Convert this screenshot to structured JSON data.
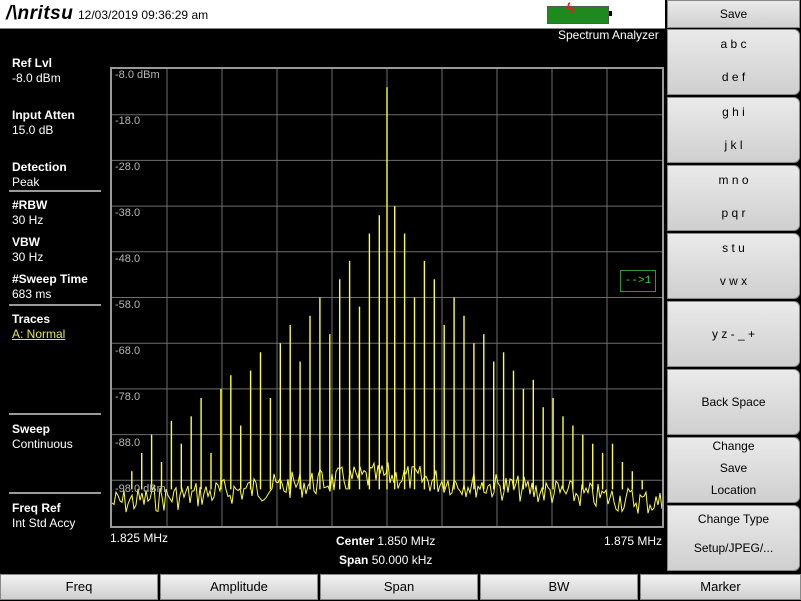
{
  "header": {
    "brand": "/\\nritsu",
    "datetime": "12/03/2019 09:36:29 am",
    "mode": "Spectrum Analyzer"
  },
  "left_panel": {
    "ref_lvl_label": "Ref Lvl",
    "ref_lvl_value": "-8.0 dBm",
    "input_atten_label": "Input Atten",
    "input_atten_value": "15.0 dB",
    "detection_label": "Detection",
    "detection_value": "Peak",
    "rbw_label": "#RBW",
    "rbw_value": "30 Hz",
    "vbw_label": "VBW",
    "vbw_value": "30 Hz",
    "sweep_time_label": "#Sweep Time",
    "sweep_time_value": "683 ms",
    "traces_label": "Traces",
    "traces_value": "A: Normal",
    "sweep_label": "Sweep",
    "sweep_value": "Continuous",
    "freq_ref_label": "Freq Ref",
    "freq_ref_value": "Int Std Accy"
  },
  "plot": {
    "y_labels": [
      "-8.0 dBm",
      "-18.0",
      "-28.0",
      "-38.0",
      "-48.0",
      "-58.0",
      "-68.0",
      "-78.0",
      "-88.0",
      "-98.0 dBm"
    ],
    "x_start": "1.825 MHz",
    "x_stop": "1.875 MHz",
    "center_label": "Center",
    "center_value": "1.850 MHz",
    "span_label": "Span",
    "span_value": "50.000 kHz",
    "marker_indicator": "-->1",
    "trace_color": "#ffff33"
  },
  "chart_data": {
    "type": "line",
    "x_unit": "MHz",
    "y_unit": "dBm",
    "xlim": [
      1.825,
      1.875
    ],
    "ylim": [
      -108,
      -8
    ],
    "grid": true,
    "peaks": {
      "x": [
        1.8268,
        1.8277,
        1.8286,
        1.8295,
        1.8304,
        1.8313,
        1.8322,
        1.8331,
        1.834,
        1.8349,
        1.8358,
        1.8367,
        1.8376,
        1.8385,
        1.8394,
        1.8403,
        1.8412,
        1.8421,
        1.843,
        1.8439,
        1.8448,
        1.8457,
        1.8466,
        1.8475,
        1.8484,
        1.8493,
        1.85,
        1.8507,
        1.8516,
        1.8525,
        1.8534,
        1.8543,
        1.8552,
        1.8561,
        1.857,
        1.8579,
        1.8588,
        1.8597,
        1.8606,
        1.8615,
        1.8624,
        1.8633,
        1.8642,
        1.8651,
        1.866,
        1.8669,
        1.8678,
        1.8687,
        1.8696,
        1.8705,
        1.8714,
        1.8723,
        1.8732
      ],
      "y": [
        -96,
        -92,
        -88,
        -94,
        -85,
        -90,
        -84,
        -80,
        -92,
        -78,
        -75,
        -86,
        -74,
        -70,
        -80,
        -68,
        -64,
        -72,
        -62,
        -58,
        -66,
        -54,
        -50,
        -60,
        -44,
        -40,
        -12,
        -38,
        -44,
        -58,
        -50,
        -54,
        -64,
        -58,
        -62,
        -68,
        -66,
        -72,
        -70,
        -74,
        -78,
        -76,
        -82,
        -80,
        -84,
        -86,
        -88,
        -90,
        -92,
        -90,
        -94,
        -96,
        -98
      ]
    }
  },
  "soft_keys": {
    "title": "Save",
    "k1_top": "a b c",
    "k1_bottom": "d e f",
    "k2_top": "g h i",
    "k2_bottom": "j k l",
    "k3_top": "m n o",
    "k3_bottom": "p q r",
    "k4_top": "s t u",
    "k4_bottom": "v w x",
    "k5": "y z - _ +",
    "k6": "Back Space",
    "k7_l1": "Change",
    "k7_l2": "Save",
    "k7_l3": "Location",
    "k8_l1": "Change Type",
    "k8_l2": "Setup/JPEG/..."
  },
  "bottom_keys": [
    "Freq",
    "Amplitude",
    "Span",
    "BW",
    "Marker"
  ]
}
